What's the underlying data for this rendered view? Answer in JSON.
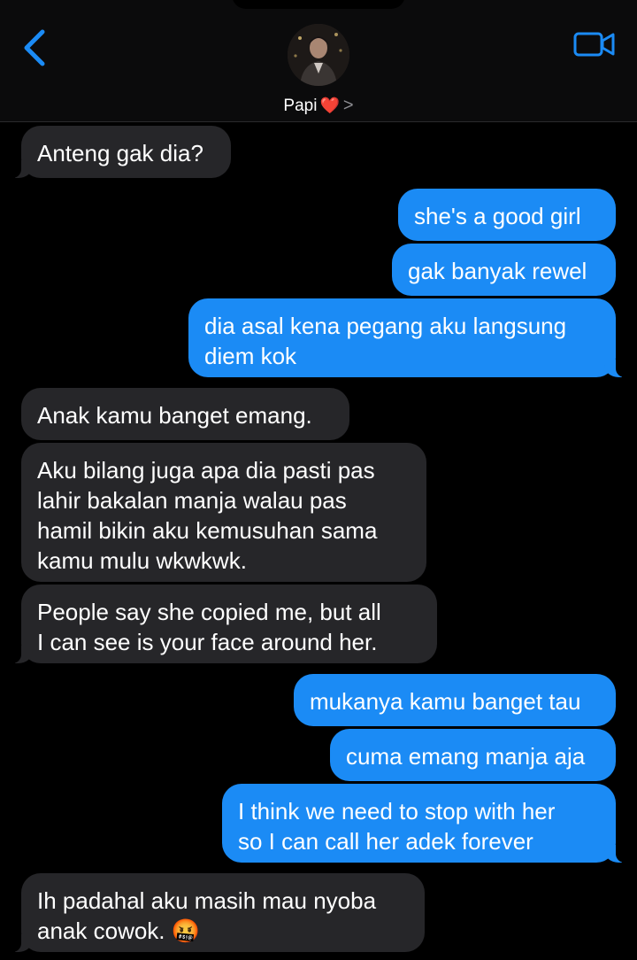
{
  "header": {
    "contact_name": "Papi",
    "heart": "❤️",
    "chevron": ">",
    "back_icon": "chevron-left-icon",
    "video_icon": "video-camera-icon",
    "accent_color": "#1b8bf5"
  },
  "messages": [
    {
      "from": "them",
      "lines": [
        "Anteng gak dia?"
      ]
    },
    {
      "from": "me",
      "lines": [
        "she's a good girl"
      ]
    },
    {
      "from": "me",
      "lines": [
        "gak banyak rewel"
      ]
    },
    {
      "from": "me",
      "lines": [
        "dia asal kena pegang aku langsung",
        "diem kok"
      ]
    },
    {
      "from": "them",
      "lines": [
        "Anak kamu banget emang."
      ]
    },
    {
      "from": "them",
      "lines": [
        "Aku bilang juga apa dia pasti pas",
        "lahir bakalan manja walau pas",
        "hamil bikin aku kemusuhan sama",
        "kamu mulu wkwkwk."
      ]
    },
    {
      "from": "them",
      "lines": [
        "People say she copied me, but all",
        "I can see is your face around her."
      ]
    },
    {
      "from": "me",
      "lines": [
        "mukanya kamu banget tau"
      ]
    },
    {
      "from": "me",
      "lines": [
        "cuma emang manja aja"
      ]
    },
    {
      "from": "me",
      "lines": [
        "I think we need to stop with her",
        "so I can call her adek forever"
      ]
    },
    {
      "from": "them",
      "lines": [
        "Ih padahal aku masih mau nyoba",
        "anak cowok."
      ],
      "emoji": "🤬"
    }
  ]
}
